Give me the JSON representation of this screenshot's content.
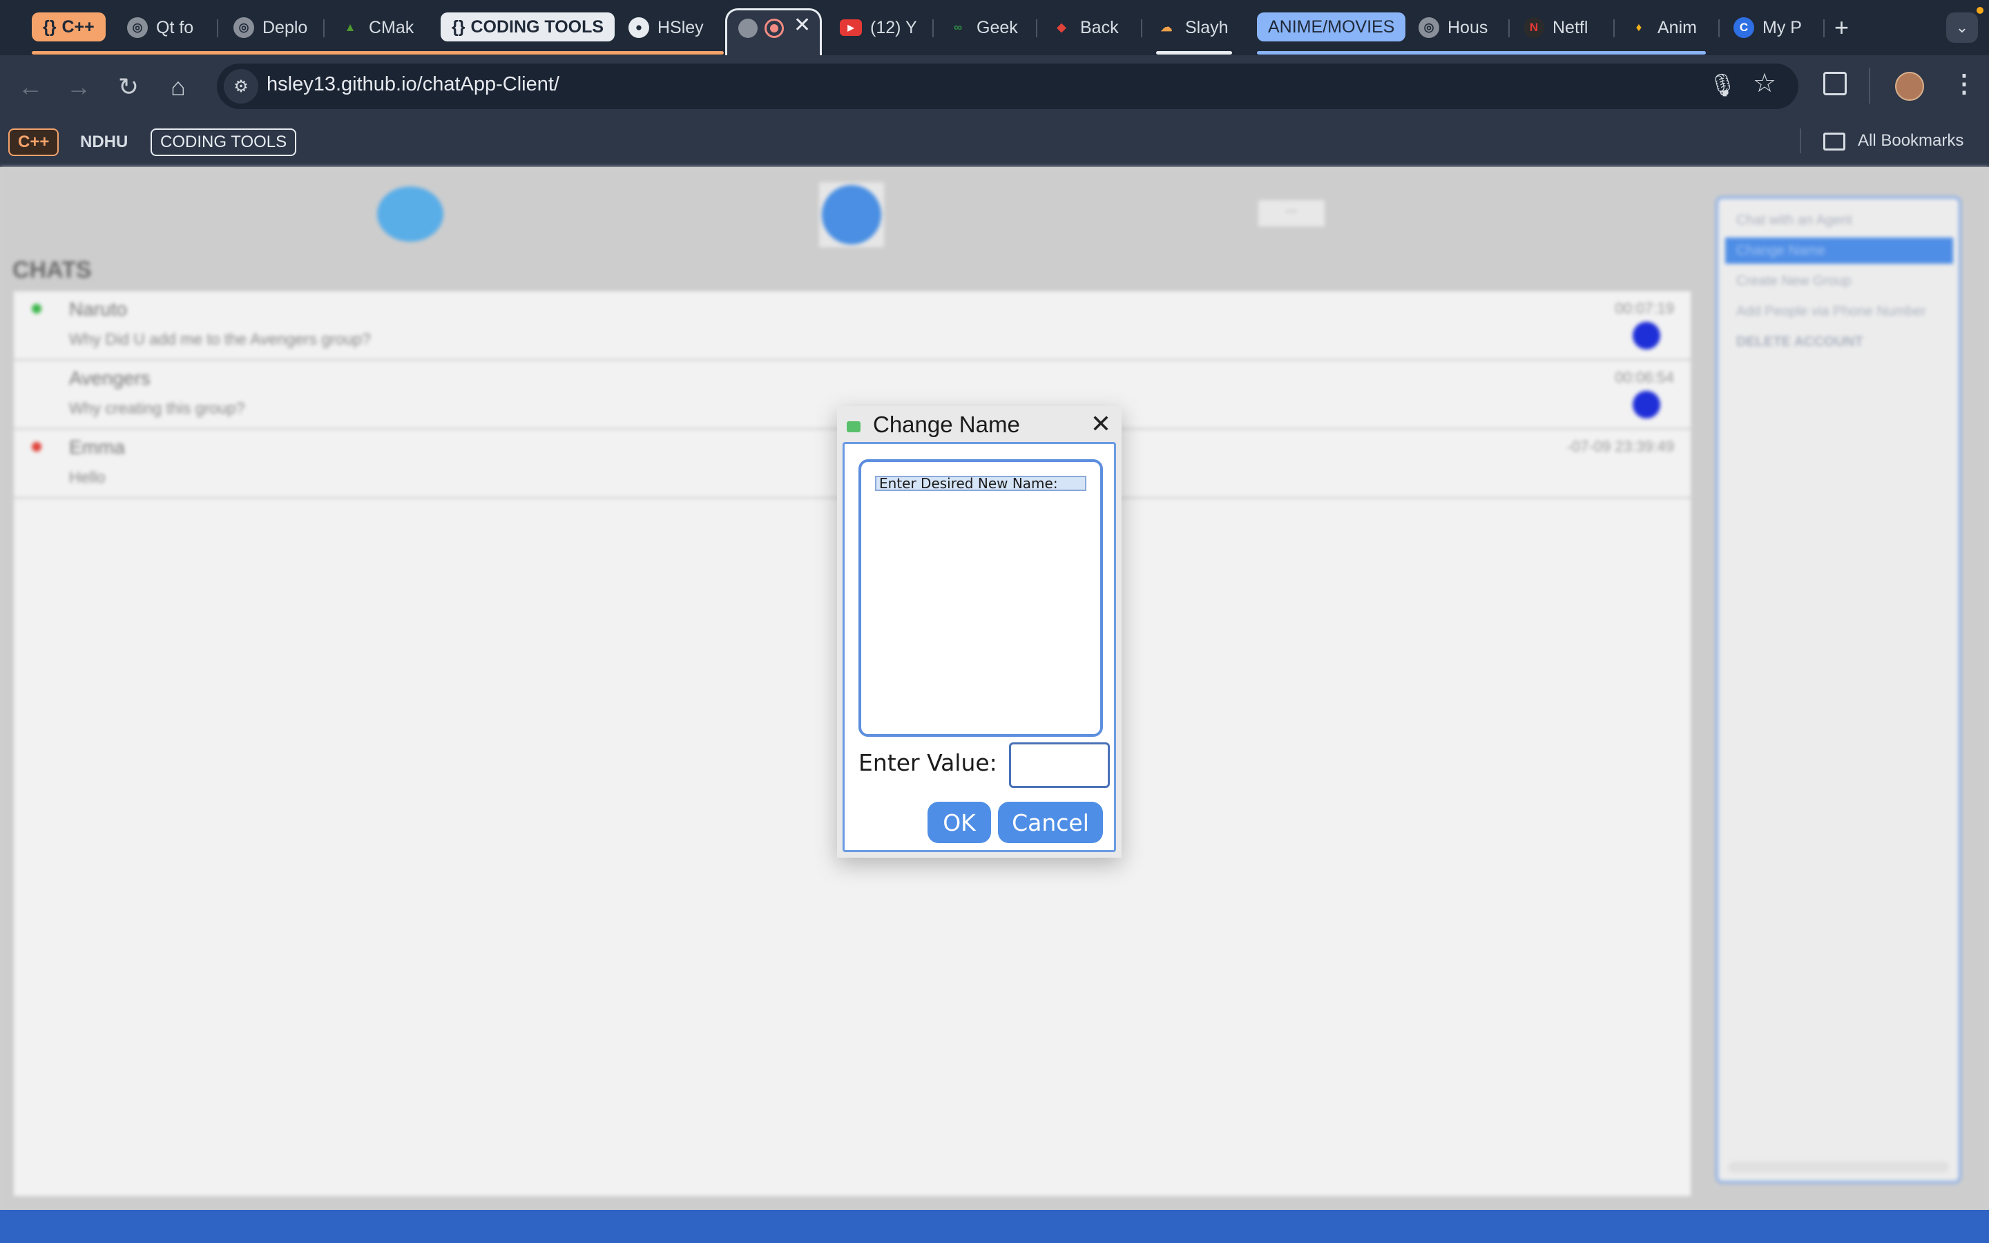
{
  "tab_groups": [
    {
      "label": "C++",
      "color": "#f5a36b"
    },
    {
      "label": "CODING TOOLS",
      "color": "#e8ecf1"
    },
    {
      "label": "ANIME/MOVIES",
      "color": "#8ab4f8"
    }
  ],
  "tabs": [
    {
      "label": "Qt fo",
      "icon": "qt-icon"
    },
    {
      "label": "Deplo",
      "icon": "globe-icon"
    },
    {
      "label": "CMak",
      "icon": "cmake-icon"
    },
    {
      "label": "HSley",
      "icon": "github-icon"
    },
    {
      "label": "(12) Y",
      "icon": "youtube-icon"
    },
    {
      "label": "Geek",
      "icon": "geeksforgeeks-icon"
    },
    {
      "label": "Back",
      "icon": "car-icon"
    },
    {
      "label": "Slayh",
      "icon": "cloud-icon"
    },
    {
      "label": "Hous",
      "icon": "globe-icon"
    },
    {
      "label": "Netfl",
      "icon": "netflix-icon"
    },
    {
      "label": "Anim",
      "icon": "flame-icon"
    },
    {
      "label": "My P",
      "icon": "c-icon"
    }
  ],
  "address_bar": {
    "url": "hsley13.github.io/chatApp-Client/"
  },
  "bookmarks": {
    "items": [
      {
        "label": "C++"
      },
      {
        "label": "NDHU"
      },
      {
        "label": "CODING TOOLS"
      }
    ],
    "all_bookmarks_label": "All Bookmarks"
  },
  "page": {
    "chats_title": "CHATS",
    "header_button": "...",
    "chats": [
      {
        "name": "Naruto",
        "message": "Why Did U add me to the Avengers group?",
        "time": "00:07:19",
        "status_color": "#3cb64a",
        "unread": true
      },
      {
        "name": "Avengers",
        "message": "Why creating this group?",
        "time": "00:06:54",
        "status_color": "",
        "unread": true
      },
      {
        "name": "Emma",
        "message": "Hello",
        "time": "-07-09 23:39:49",
        "status_color": "#e0433a",
        "unread": false
      }
    ],
    "menu_items": [
      {
        "label": "Chat with an Agent"
      },
      {
        "label": "Change Name"
      },
      {
        "label": "Create New Group"
      },
      {
        "label": "Add People via Phone Number"
      },
      {
        "label": "DELETE ACCOUNT"
      }
    ]
  },
  "dialog": {
    "title": "Change Name",
    "list_items": [
      "Enter Desired New Name:"
    ],
    "input_label": "Enter Value:",
    "input_value": "",
    "ok_label": "OK",
    "cancel_label": "Cancel"
  }
}
